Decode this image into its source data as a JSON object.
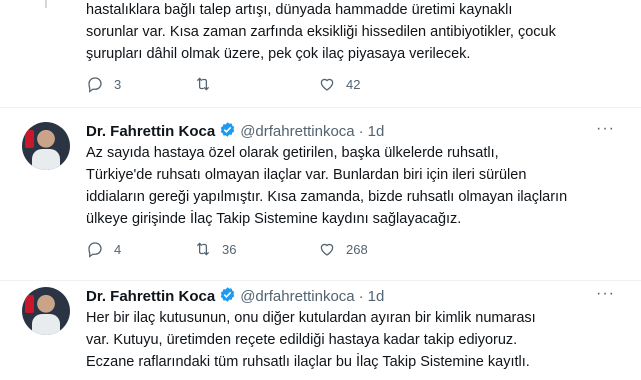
{
  "tweets": [
    {
      "text_lines": [
        "hastalıklara bağlı talep artışı, dünyada hammadde üretimi kaynaklı",
        "sorunlar var. Kısa zaman zarfında eksikliği hissedilen antibiyotikler, çocuk",
        "şurupları dâhil olmak üzere, pek çok ilaç piyasaya verilecek."
      ],
      "replies": "3",
      "retweets": "",
      "likes": "42"
    },
    {
      "name": "Dr. Fahrettin Koca",
      "handle": "@drfahrettinkoca",
      "dot": "·",
      "time": "1d",
      "more": "···",
      "text_lines": [
        "Az sayıda hastaya özel olarak getirilen, başka ülkelerde ruhsatlı,",
        "Türkiye'de ruhsatı olmayan ilaçlar var. Bunlardan biri için ileri sürülen",
        "iddiaların gereği yapılmıştır. Kısa zamanda, bizde ruhsatlı olmayan ilaçların",
        "ülkeye girişinde İlaç Takip Sistemine kaydını sağlayacağız."
      ],
      "replies": "4",
      "retweets": "36",
      "likes": "268"
    },
    {
      "name": "Dr. Fahrettin Koca",
      "handle": "@drfahrettinkoca",
      "dot": "·",
      "time": "1d",
      "more": "···",
      "text_lines": [
        "Her bir ilaç kutusunun, onu diğer kutulardan ayıran bir kimlik numarası",
        "var. Kutuyu, üretimden reçete edildiği hastaya kadar takip ediyoruz.",
        "Eczane raflarındaki tüm ruhsatlı ilaçlar bu İlaç Takip Sistemine kayıtlı."
      ]
    }
  ],
  "icons": {
    "reply": "reply-icon",
    "retweet": "retweet-icon",
    "like": "like-icon",
    "verified": "verified-badge-icon"
  },
  "colors": {
    "verified": "#1d9bf0",
    "muted": "#536471",
    "text": "#0f1419"
  }
}
